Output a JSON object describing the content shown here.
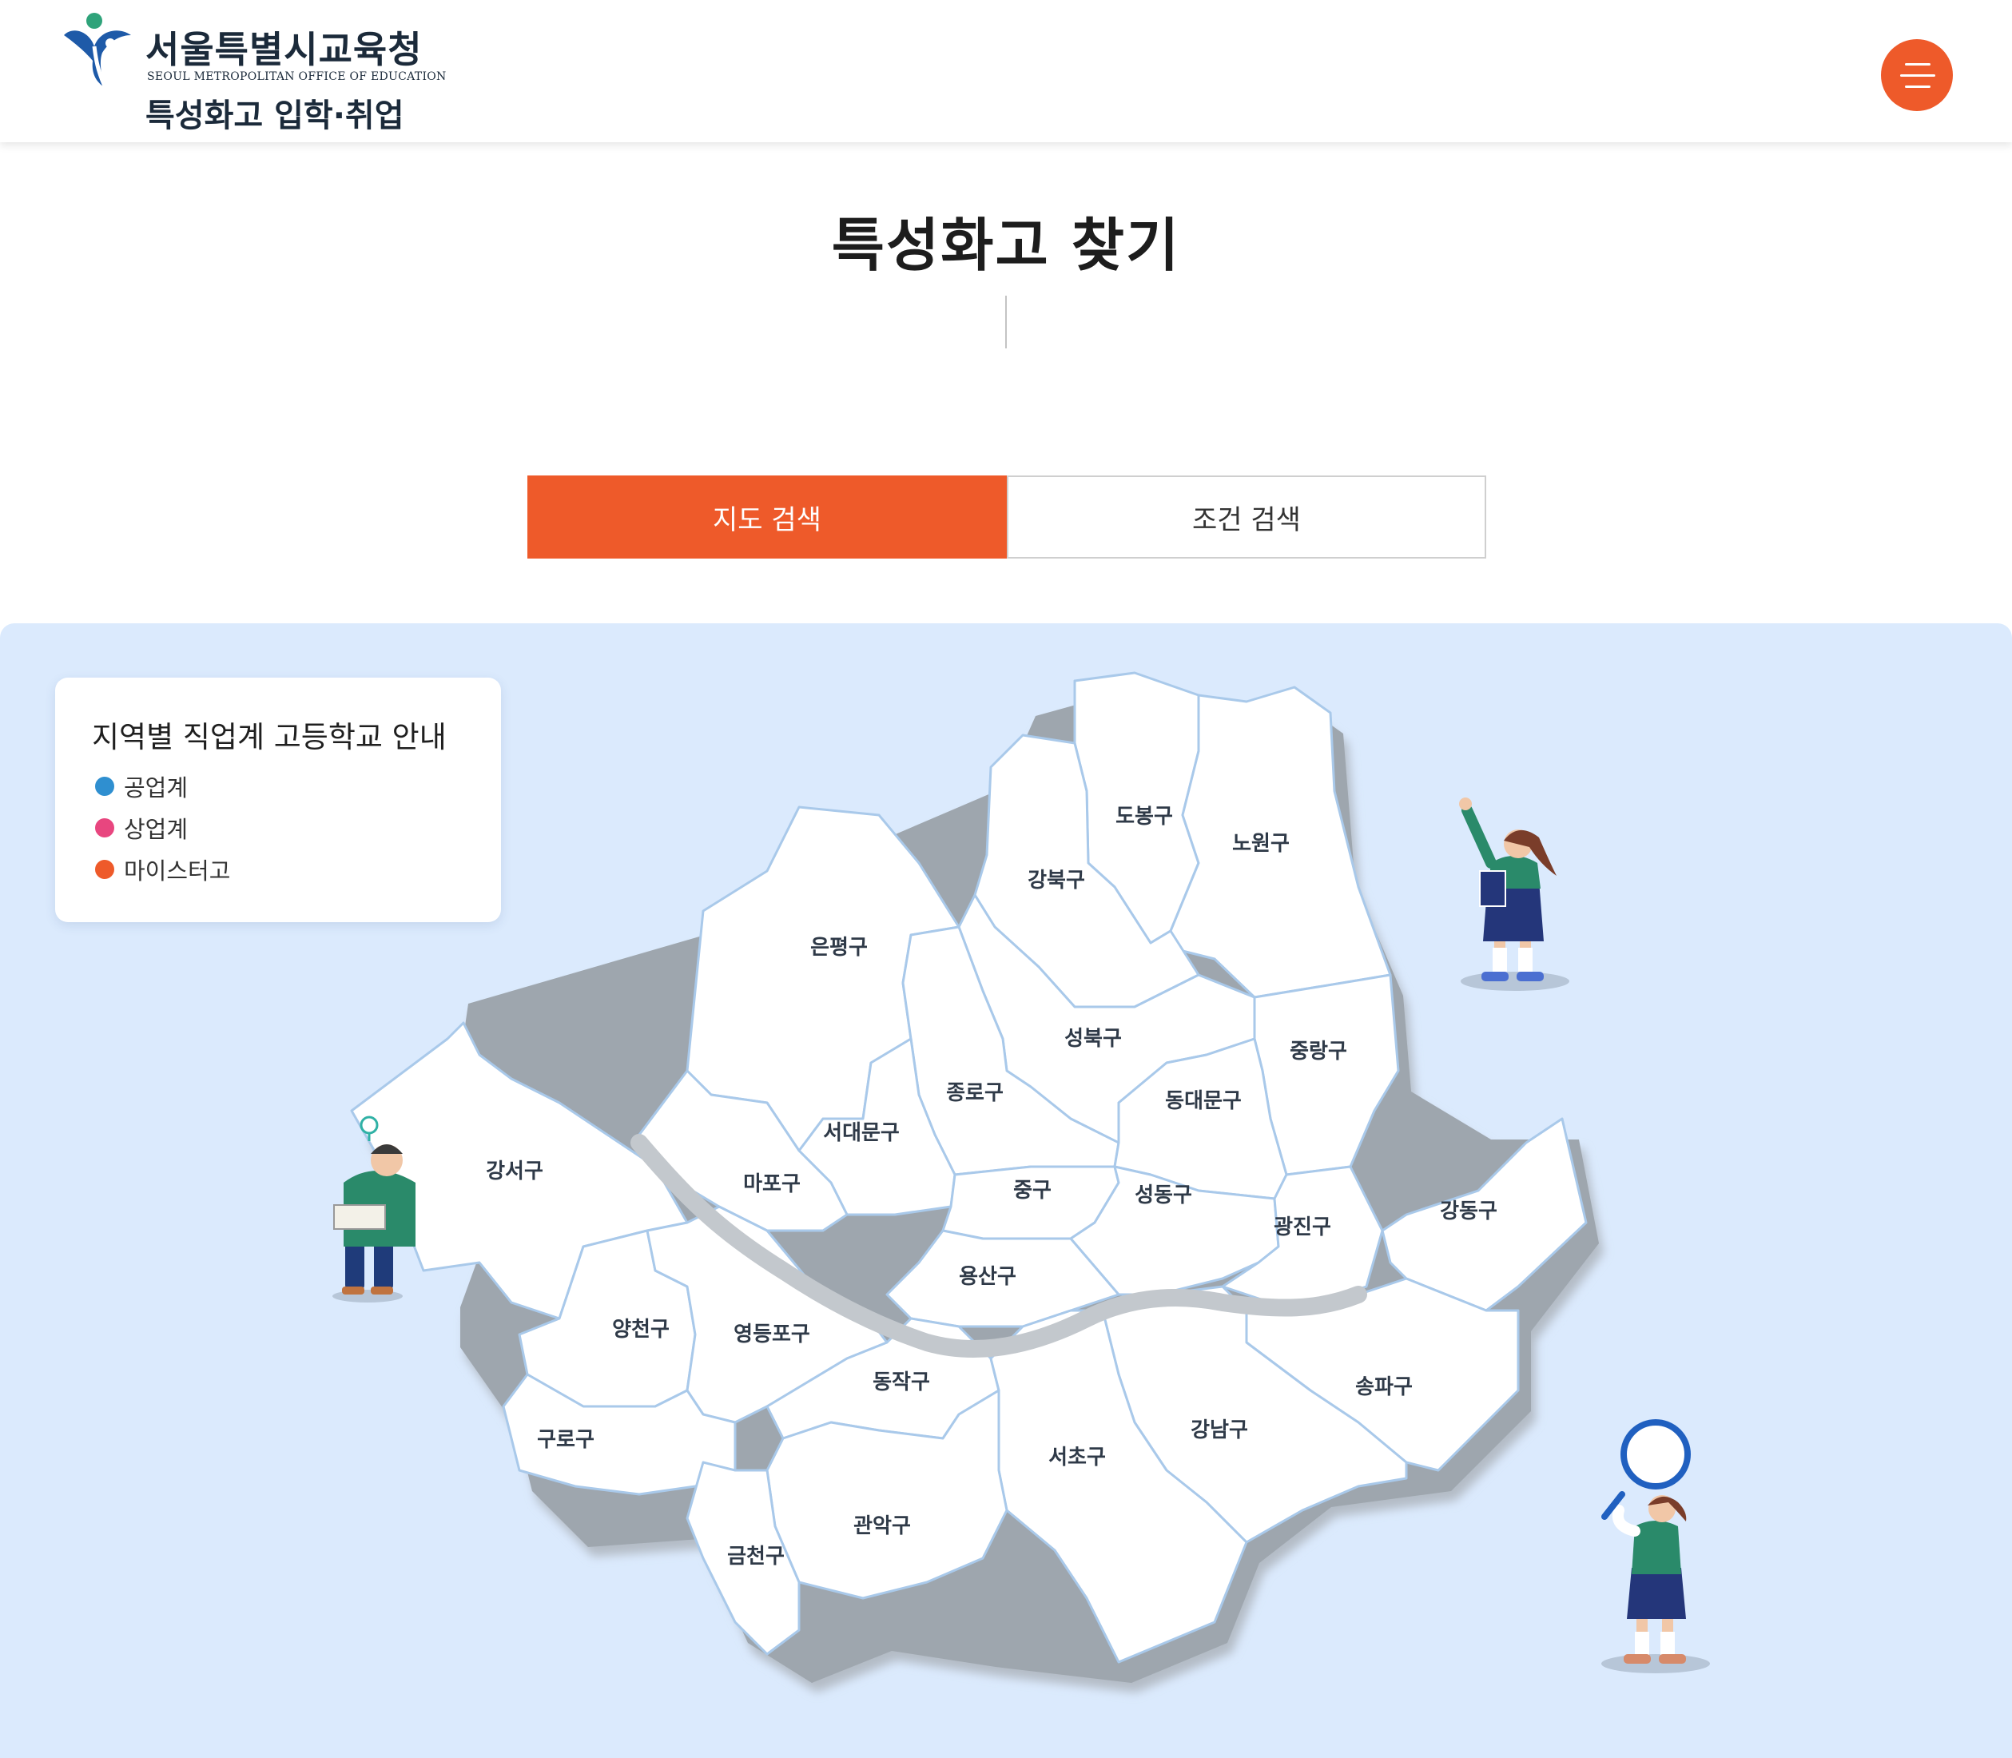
{
  "header": {
    "logo_title": "서울특별시교육청",
    "logo_english": "SEOUL METROPOLITAN OFFICE OF EDUCATION",
    "logo_subtitle": "특성화고 입학·취업",
    "menu_icon": "hamburger-menu-icon",
    "accent_color": "#ee5a2a"
  },
  "page": {
    "title": "특성화고 찾기"
  },
  "tabs": [
    {
      "label": "지도 검색",
      "active": true
    },
    {
      "label": "조건 검색",
      "active": false
    }
  ],
  "legend": {
    "title": "지역별 직업계 고등학교 안내",
    "items": [
      {
        "label": "공업계",
        "color": "#2f8fd0"
      },
      {
        "label": "상업계",
        "color": "#e8467f"
      },
      {
        "label": "마이스터고",
        "color": "#ee5a2a"
      }
    ]
  },
  "map": {
    "districts": [
      {
        "id": "dobong",
        "label": "도봉구"
      },
      {
        "id": "nowon",
        "label": "노원구"
      },
      {
        "id": "gangbuk",
        "label": "강북구"
      },
      {
        "id": "eunpyeong",
        "label": "은평구"
      },
      {
        "id": "seongbuk",
        "label": "성북구"
      },
      {
        "id": "jungnang",
        "label": "중랑구"
      },
      {
        "id": "jongno",
        "label": "종로구"
      },
      {
        "id": "dongdaemun",
        "label": "동대문구"
      },
      {
        "id": "seodaemun",
        "label": "서대문구"
      },
      {
        "id": "gangseo",
        "label": "강서구"
      },
      {
        "id": "mapo",
        "label": "마포구"
      },
      {
        "id": "jung",
        "label": "중구"
      },
      {
        "id": "seongdong",
        "label": "성동구"
      },
      {
        "id": "gwangjin",
        "label": "광진구"
      },
      {
        "id": "gangdong",
        "label": "강동구"
      },
      {
        "id": "yongsan",
        "label": "용산구"
      },
      {
        "id": "yangcheon",
        "label": "양천구"
      },
      {
        "id": "yeongdeungpo",
        "label": "영등포구"
      },
      {
        "id": "songpa",
        "label": "송파구"
      },
      {
        "id": "dongjak",
        "label": "동작구"
      },
      {
        "id": "gangnam",
        "label": "강남구"
      },
      {
        "id": "guro",
        "label": "구로구"
      },
      {
        "id": "seocho",
        "label": "서초구"
      },
      {
        "id": "gwanak",
        "label": "관악구"
      },
      {
        "id": "geumcheon",
        "label": "금천구"
      }
    ],
    "background_color": "#dbeafd",
    "district_fill": "#ffffff",
    "boundary_color": "#a9c9ea",
    "river_color": "#c3c8cd"
  }
}
